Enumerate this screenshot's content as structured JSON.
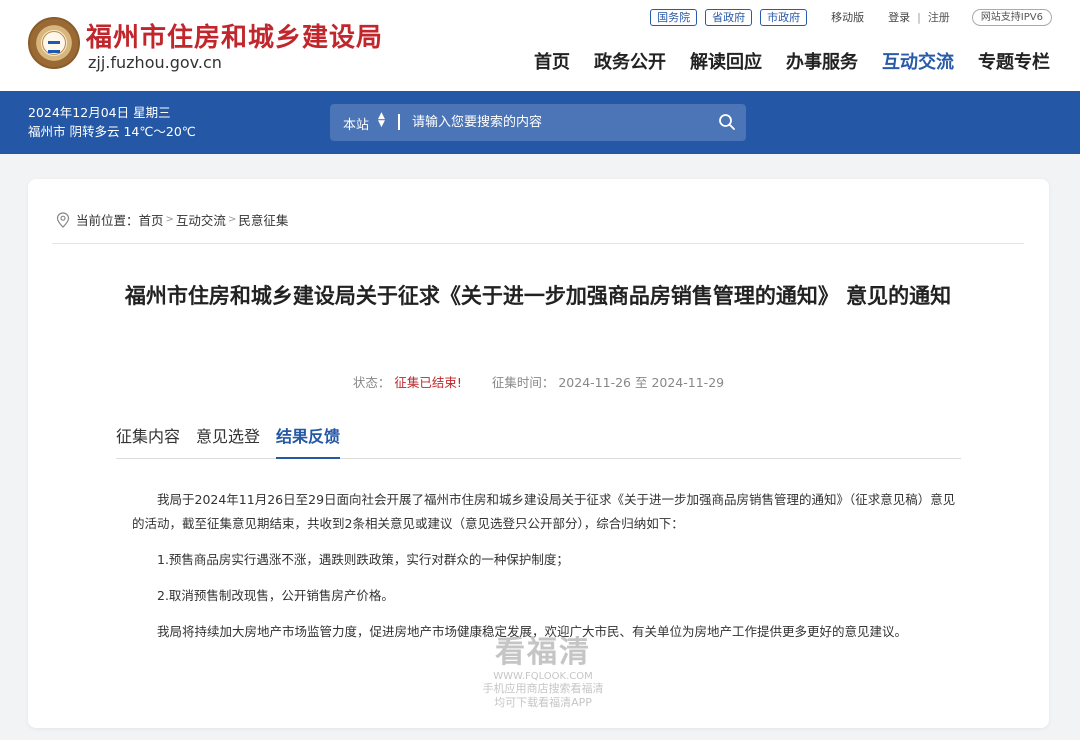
{
  "header": {
    "site_name": "福州市住房和城乡建设局",
    "site_domain": "zjj.fuzhou.gov.cn",
    "gov_links": [
      "国务院",
      "省政府",
      "市政府"
    ],
    "mobile_label": "移动版",
    "login_label": "登录",
    "register_label": "注册",
    "ipv6_label": "网站支持IPV6",
    "nav": [
      "首页",
      "政务公开",
      "解读回应",
      "办事服务",
      "互动交流",
      "专题专栏"
    ],
    "nav_active": "互动交流"
  },
  "band": {
    "date_line": "2024年12月04日 星期三",
    "weather_line": "福州市 阴转多云 14℃～20℃",
    "search_scope": "本站",
    "search_placeholder": "请输入您要搜索的内容"
  },
  "breadcrumb": {
    "prefix": "当前位置：",
    "items": [
      "首页",
      "互动交流",
      "民意征集"
    ]
  },
  "article": {
    "title": "福州市住房和城乡建设局关于征求《关于进一步加强商品房销售管理的通知》 意见的通知",
    "status_label": "状态：",
    "status_value": "征集已结束!",
    "period_label": "征集时间：",
    "period_value": "2024-11-26 至 2024-11-29",
    "tabs": [
      "征集内容",
      "意见选登",
      "结果反馈"
    ],
    "active_tab": "结果反馈",
    "paragraphs": [
      "我局于2024年11月26日至29日面向社会开展了福州市住房和城乡建设局关于征求《关于进一步加强商品房销售管理的通知》（征求意见稿）意见的活动，截至征集意见期结束，共收到2条相关意见或建议（意见选登只公开部分），综合归纳如下：",
      "1.预售商品房实行遇涨不涨，遇跌则跌政策，实行对群众的一种保护制度；",
      "2.取消预售制改现售，公开销售房产价格。",
      "我局将持续加大房地产市场监管力度，促进房地产市场健康稳定发展，欢迎广大市民、有关单位为房地产工作提供更多更好的意见建议。"
    ]
  },
  "watermark": {
    "brand": "看福清",
    "url": "WWW.FQLOOK.COM",
    "line1": "手机应用商店搜索看福清",
    "line2": "均可下载看福清APP"
  },
  "colors": {
    "brand_red": "#c0262b",
    "brand_blue": "#2457a6"
  }
}
